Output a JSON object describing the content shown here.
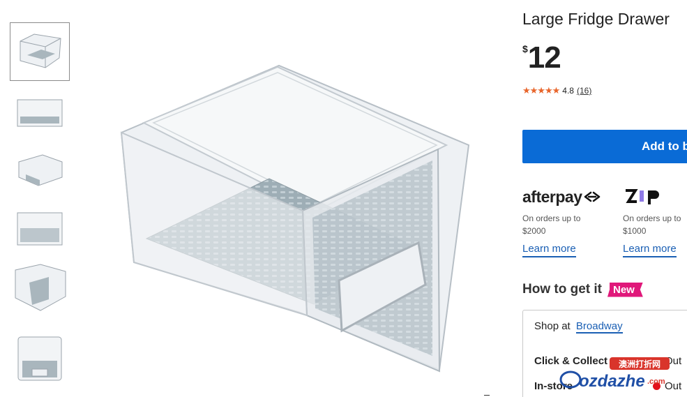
{
  "thumbnails": [
    {
      "name": "thumbnail-1",
      "selected": true
    },
    {
      "name": "thumbnail-2",
      "selected": false
    },
    {
      "name": "thumbnail-3",
      "selected": false
    },
    {
      "name": "thumbnail-4",
      "selected": false
    },
    {
      "name": "thumbnail-5",
      "selected": false
    },
    {
      "name": "thumbnail-6",
      "selected": false
    }
  ],
  "product": {
    "title": "Large Fridge Drawer",
    "price_currency": "$",
    "price": "12",
    "rating": "4.8",
    "rating_stars": 5,
    "reviews": "(16)",
    "add_label": "Add to b"
  },
  "payments": {
    "afterpay": {
      "logo": "afterpay",
      "desc_line1": "On orders up to",
      "desc_line2": "$2000",
      "learn": "Learn more"
    },
    "zip": {
      "logo": "zip",
      "desc_line1": "On orders up to",
      "desc_line2": "$1000",
      "learn": "Learn more"
    }
  },
  "fulfilment": {
    "heading": "How to get it",
    "badge": "New",
    "shop_at": "Shop at",
    "store": "Broadway",
    "click_collect": "Click & Collect",
    "click_collect_status": "Out",
    "in_store": "In-store",
    "in_store_status": "Out"
  },
  "watermark": {
    "brand": "ozdazhe",
    "suffix": ".com",
    "chinese": "澳洲打折网"
  },
  "colors": {
    "accent": "#0a6bd6",
    "badge": "#e0187a",
    "star": "#e8652b",
    "out": "#e3101b",
    "link": "#1a5fb4"
  },
  "icons": {
    "rating": "star-icon",
    "status": "red-dot-icon",
    "afterpay": "afterpay-logo-icon",
    "zip": "zip-logo-icon"
  }
}
